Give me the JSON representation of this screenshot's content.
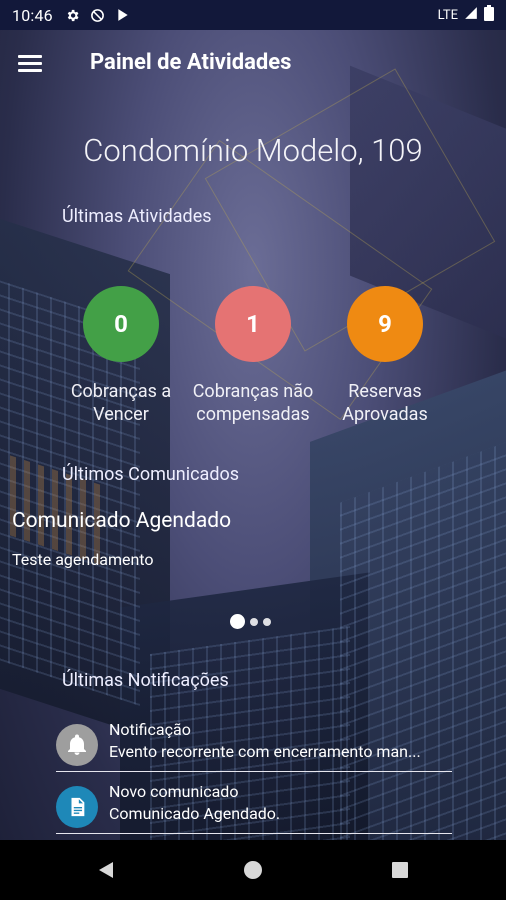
{
  "status_bar": {
    "time": "10:46",
    "network": "LTE",
    "icons": [
      "gear-icon",
      "do-not-disturb-icon",
      "play-store-icon",
      "signal-icon",
      "battery-icon"
    ]
  },
  "app_bar": {
    "title": "Painel de Atividades",
    "menu_icon": "hamburger-menu-icon"
  },
  "condominium": {
    "name": "Condomínio Modelo, 109"
  },
  "last_activities": {
    "title": "Últimas Atividades",
    "items": [
      {
        "count": "0",
        "label_line1": "Cobranças a",
        "label_line2": "Vencer",
        "color": "#43a047"
      },
      {
        "count": "1",
        "label_line1": "Cobranças não",
        "label_line2": "compensadas",
        "color": "#e57373"
      },
      {
        "count": "9",
        "label_line1": "Reservas",
        "label_line2": "Aprovadas",
        "color": "#ef8a12"
      }
    ]
  },
  "last_announcements": {
    "title": "Últimos Comunicados",
    "item": {
      "title": "Comunicado Agendado",
      "text": "Teste agendamento"
    },
    "carousel": {
      "pages": 3,
      "active_index": 0
    }
  },
  "last_notifications": {
    "title": "Últimas Notificações",
    "items": [
      {
        "title": "Notificação",
        "text": "Evento recorrente com encerramento man...",
        "icon": "bell-icon",
        "icon_bg": "#9e9e9e"
      },
      {
        "title": "Novo comunicado",
        "text": "Comunicado Agendado.",
        "icon": "document-icon",
        "icon_bg": "#1e88b8"
      }
    ]
  },
  "nav_bar": {
    "buttons": [
      "back-icon",
      "home-icon",
      "recents-icon"
    ]
  }
}
